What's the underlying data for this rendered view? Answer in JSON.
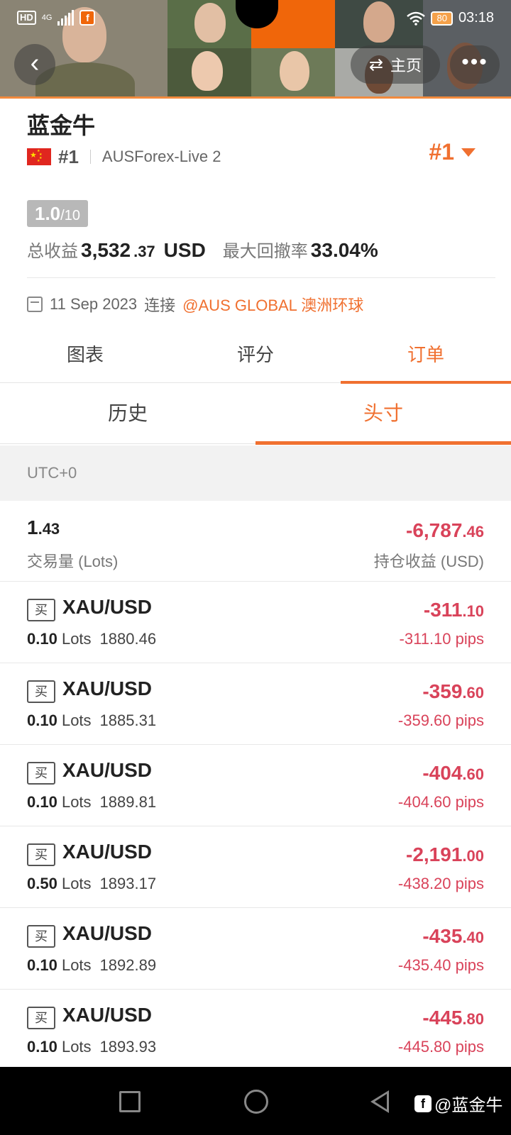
{
  "status_bar": {
    "hd": "HD",
    "network": "4G",
    "app_badge": "f",
    "battery": "80",
    "time": "03:18"
  },
  "header": {
    "back_icon": "chevron-left-icon",
    "home_label": "主页",
    "home_icon": "swap-icon",
    "more_icon": "more-dots-icon"
  },
  "profile": {
    "name": "蓝金牛",
    "rank": "#1",
    "server": "AUSForex-Live 2",
    "rank_right": "#1",
    "score": "1.0",
    "score_max": "/10",
    "total_profit_label": "总收益",
    "total_profit_int": "3,532",
    "total_profit_dec": ".37",
    "total_profit_unit": "USD",
    "max_drawdown_label": "最大回撤率",
    "max_drawdown": "33.04%",
    "connect_date": "11 Sep 2023",
    "connect_label": "连接",
    "broker": "@AUS GLOBAL 澳洲环球"
  },
  "tabs": [
    "图表",
    "评分",
    "订单"
  ],
  "subtabs": [
    "历史",
    "头寸"
  ],
  "timezone": "UTC+0",
  "summary": {
    "volume_int": "1",
    "volume_dec": ".43",
    "volume_label": "交易量 (Lots)",
    "pnl_int": "-6,787",
    "pnl_dec": ".46",
    "pnl_label": "持仓收益 (USD)"
  },
  "orders": [
    {
      "side": "买",
      "symbol": "XAU/USD",
      "lots": "0.10",
      "lots_unit": "Lots",
      "price": "1880.46",
      "pnl_int": "-311",
      "pnl_dec": ".10",
      "pips": "-311.10 pips"
    },
    {
      "side": "买",
      "symbol": "XAU/USD",
      "lots": "0.10",
      "lots_unit": "Lots",
      "price": "1885.31",
      "pnl_int": "-359",
      "pnl_dec": ".60",
      "pips": "-359.60 pips"
    },
    {
      "side": "买",
      "symbol": "XAU/USD",
      "lots": "0.10",
      "lots_unit": "Lots",
      "price": "1889.81",
      "pnl_int": "-404",
      "pnl_dec": ".60",
      "pips": "-404.60 pips"
    },
    {
      "side": "买",
      "symbol": "XAU/USD",
      "lots": "0.50",
      "lots_unit": "Lots",
      "price": "1893.17",
      "pnl_int": "-2,191",
      "pnl_dec": ".00",
      "pips": "-438.20 pips"
    },
    {
      "side": "买",
      "symbol": "XAU/USD",
      "lots": "0.10",
      "lots_unit": "Lots",
      "price": "1892.89",
      "pnl_int": "-435",
      "pnl_dec": ".40",
      "pips": "-435.40 pips"
    },
    {
      "side": "买",
      "symbol": "XAU/USD",
      "lots": "0.10",
      "lots_unit": "Lots",
      "price": "1893.93",
      "pnl_int": "-445",
      "pnl_dec": ".80",
      "pips": "-445.80 pips"
    }
  ],
  "watermark": {
    "logo": "f",
    "text": "@蓝金牛"
  },
  "colors": {
    "accent": "#f07030",
    "loss": "#d9435a",
    "banner_orange": "#f0660a"
  }
}
